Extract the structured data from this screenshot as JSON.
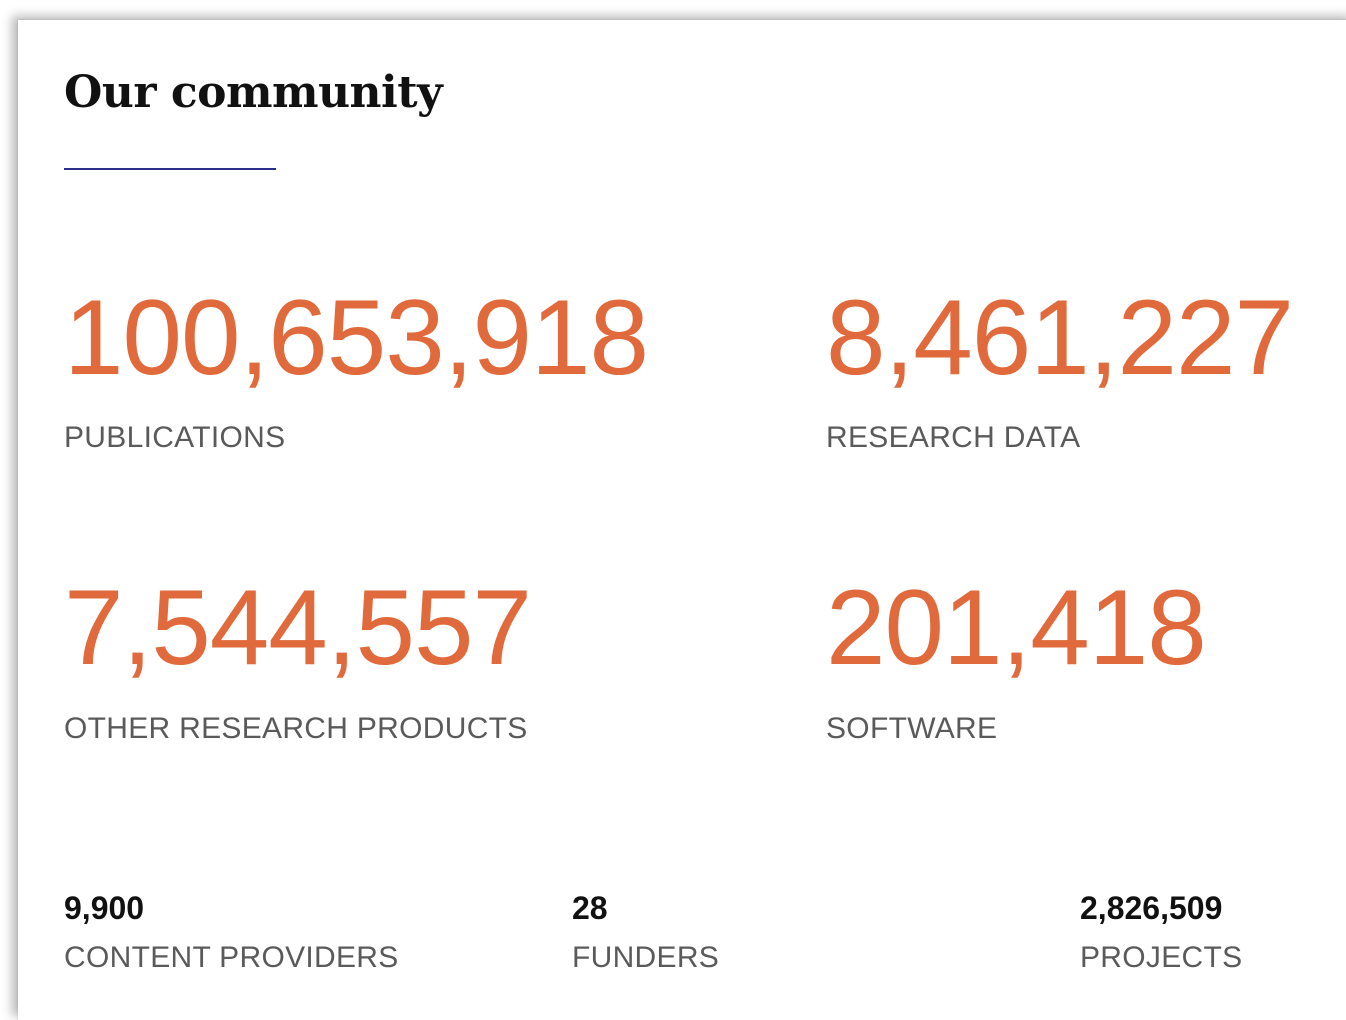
{
  "section": {
    "title": "Our community",
    "accent_color": "#e06a3b",
    "underline_color": "#2b2f8c"
  },
  "main_stats": [
    {
      "value": "100,653,918",
      "label": "PUBLICATIONS"
    },
    {
      "value": "8,461,227",
      "label": "RESEARCH DATA"
    },
    {
      "value": "7,544,557",
      "label": "OTHER RESEARCH PRODUCTS"
    },
    {
      "value": "201,418",
      "label": "SOFTWARE"
    }
  ],
  "secondary_stats": [
    {
      "value": "9,900",
      "label": "CONTENT PROVIDERS"
    },
    {
      "value": "28",
      "label": "FUNDERS"
    },
    {
      "value": "2,826,509",
      "label": "PROJECTS"
    }
  ]
}
